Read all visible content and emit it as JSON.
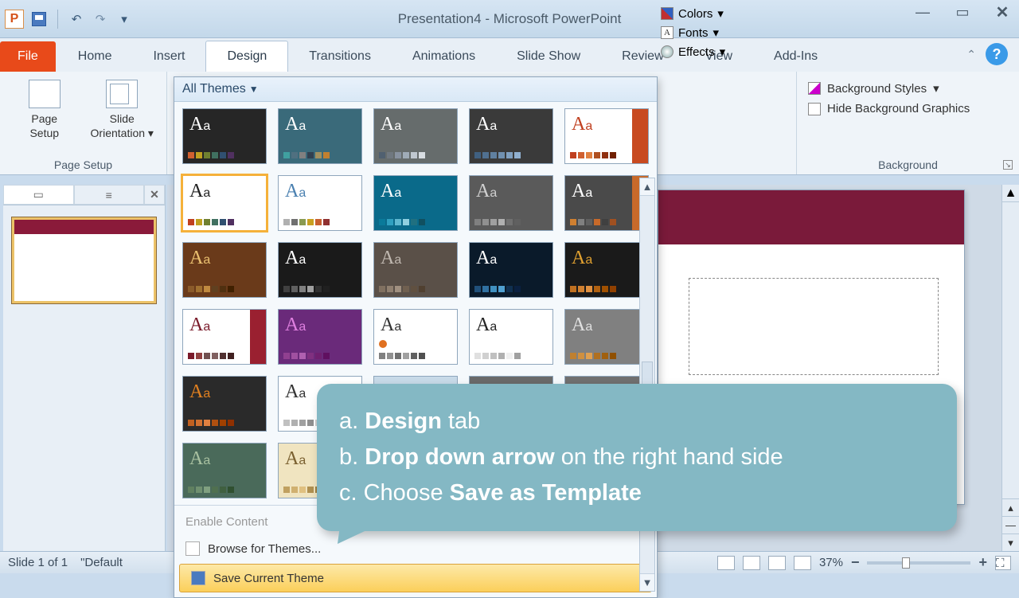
{
  "title": "Presentation4 - Microsoft PowerPoint",
  "qat": {
    "undo": "↶",
    "redo": "↷"
  },
  "tabs": {
    "file": "File",
    "items": [
      "Home",
      "Insert",
      "Design",
      "Transitions",
      "Animations",
      "Slide Show",
      "Review",
      "View",
      "Add-Ins"
    ],
    "active_index": 2
  },
  "page_setup": {
    "page_setup": "Page\nSetup",
    "slide_orientation": "Slide\nOrientation",
    "group": "Page Setup"
  },
  "themes": {
    "header": "All Themes",
    "thumbs": [
      {
        "bg": "#262626",
        "fg": "#ffffff",
        "strip": [
          "#d06030",
          "#c0a020",
          "#708030",
          "#407060",
          "#305070",
          "#503060"
        ]
      },
      {
        "bg": "#3a6a7a",
        "fg": "#ffffff",
        "strip": [
          "#40a0a0",
          "#507080",
          "#808080",
          "#304050",
          "#a09060",
          "#c08030"
        ]
      },
      {
        "bg": "#666c6c",
        "fg": "#ffffff",
        "strip": [
          "#506070",
          "#707880",
          "#8892a0",
          "#a0acb8",
          "#c0c8d0",
          "#d8dde2"
        ]
      },
      {
        "bg": "#3a3a3a",
        "fg": "#ffffff",
        "strip": [
          "#406080",
          "#507090",
          "#6080a0",
          "#7090b0",
          "#80a0c0",
          "#90b0d0"
        ]
      },
      {
        "bg": "#ffffff",
        "fg": "#c04020",
        "strip": [
          "#c04020",
          "#d06030",
          "#e08040",
          "#b05020",
          "#903010",
          "#702000"
        ],
        "accent": "#c84a20"
      },
      {
        "bg": "#ffffff",
        "fg": "#222222",
        "strip": [
          "#c04020",
          "#c0a020",
          "#708030",
          "#407060",
          "#305070",
          "#503060"
        ],
        "sel": true
      },
      {
        "bg": "#ffffff",
        "fg": "#4a80b0",
        "strip": [
          "#b0b0b0",
          "#707070",
          "#8a9a50",
          "#c8a020",
          "#c86030",
          "#903030"
        ]
      },
      {
        "bg": "#0a6a8a",
        "fg": "#ffffff",
        "strip": [
          "#0a7a9a",
          "#30a0c0",
          "#60b8d0",
          "#90d0e0",
          "#207080",
          "#105060"
        ]
      },
      {
        "bg": "#5a5a5a",
        "fg": "#d0d0d0",
        "strip": [
          "#808080",
          "#909090",
          "#a0a0a0",
          "#b0b0b0",
          "#707070",
          "#606060"
        ]
      },
      {
        "bg": "#4a4a4a",
        "fg": "#ffffff",
        "strip": [
          "#d08030",
          "#808080",
          "#606060",
          "#c86a2a",
          "#404040",
          "#a05020"
        ],
        "accent": "#c86a2a"
      },
      {
        "bg": "#6a3a1a",
        "fg": "#eac070",
        "strip": [
          "#8a5a2a",
          "#a07030",
          "#c08a40",
          "#604020",
          "#503010",
          "#402000"
        ]
      },
      {
        "bg": "#1a1a1a",
        "fg": "#ffffff",
        "strip": [
          "#404040",
          "#606060",
          "#808080",
          "#a0a0a0",
          "#303030",
          "#202020"
        ]
      },
      {
        "bg": "#5a5048",
        "fg": "#c0b8b0",
        "strip": [
          "#807060",
          "#908070",
          "#a09080",
          "#706050",
          "#605040",
          "#504030"
        ]
      },
      {
        "bg": "#0a1a2a",
        "fg": "#ffffff",
        "strip": [
          "#20507a",
          "#3070a0",
          "#4090c0",
          "#50a0d0",
          "#103050",
          "#0a2040"
        ]
      },
      {
        "bg": "#1a1a1a",
        "fg": "#e0a030",
        "strip": [
          "#c07020",
          "#d08030",
          "#e09040",
          "#b06010",
          "#a05000",
          "#904000"
        ]
      },
      {
        "bg": "#ffffff",
        "fg": "#7a1a2a",
        "strip": [
          "#7a1a2a",
          "#904040",
          "#705050",
          "#806060",
          "#503030",
          "#402020"
        ],
        "accent": "#9a2030"
      },
      {
        "bg": "#6a2a7a",
        "fg": "#e080e0",
        "strip": [
          "#904090",
          "#a050a0",
          "#b060b0",
          "#803080",
          "#702070",
          "#601060"
        ]
      },
      {
        "bg": "#ffffff",
        "fg": "#333333",
        "strip": [
          "#808080",
          "#909090",
          "#707070",
          "#a0a0a0",
          "#606060",
          "#505050"
        ],
        "dot": "#e07020"
      },
      {
        "bg": "#ffffff",
        "fg": "#222222",
        "strip": [
          "#e0e0e0",
          "#d0d0d0",
          "#c0c0c0",
          "#b0b0b0",
          "#f0f0f0",
          "#a0a0a0"
        ]
      },
      {
        "bg": "#808080",
        "fg": "#e0e0e0",
        "strip": [
          "#c08030",
          "#d09040",
          "#e0a050",
          "#b07020",
          "#a06010",
          "#905000"
        ]
      },
      {
        "bg": "#2a2a2a",
        "fg": "#e08020",
        "strip": [
          "#c06020",
          "#d07030",
          "#e08040",
          "#b05010",
          "#a04000",
          "#903000"
        ]
      },
      {
        "bg": "#ffffff",
        "fg": "#333333",
        "strip": [
          "#c0c0c0",
          "#b0b0b0",
          "#a0a0a0",
          "#909090",
          "#d0d0d0",
          "#808080"
        ]
      },
      {
        "bg": "#c8dae8",
        "fg": "#506070",
        "strip": [
          "#90a8c0",
          "#a0b8d0",
          "#b0c8e0",
          "#8098b0",
          "#7088a0",
          "#607890"
        ]
      },
      {
        "bg": "#6a6a6a",
        "fg": "#d0d0d0",
        "strip": [
          "#808080",
          "#909090",
          "#a0a0a0",
          "#707070",
          "#606060",
          "#b0b0b0"
        ]
      },
      {
        "bg": "#707070",
        "fg": "#ffffff",
        "strip": [
          "#909090",
          "#a0a0a0",
          "#808080",
          "#b0b0b0",
          "#707070",
          "#606060"
        ]
      },
      {
        "bg": "#4a6a5a",
        "fg": "#a8c0a0",
        "strip": [
          "#608060",
          "#709070",
          "#80a080",
          "#507050",
          "#406040",
          "#305030"
        ]
      },
      {
        "bg": "#f0e4c0",
        "fg": "#7a6030",
        "strip": [
          "#c0a060",
          "#d0b070",
          "#e0c080",
          "#b09050",
          "#a08040",
          "#907030"
        ]
      }
    ],
    "menu": {
      "enable_content": "Enable Content",
      "browse": "Browse for Themes...",
      "save": "Save Current Theme"
    }
  },
  "variants": {
    "colors": "Colors",
    "fonts": "Fonts",
    "effects": "Effects"
  },
  "background": {
    "styles": "Background Styles",
    "hide": "Hide Background Graphics",
    "group": "Background"
  },
  "slides": {
    "number": "1"
  },
  "callout": {
    "a_pre": "a. ",
    "a_bold": "Design",
    "a_post": " tab",
    "b_pre": "b. ",
    "b_bold": "Drop down arrow",
    "b_post": " on the right hand side",
    "c_pre": "c. Choose ",
    "c_bold": "Save as Template",
    "c_post": ""
  },
  "status": {
    "slide": "Slide 1 of 1",
    "theme": "\"Default",
    "zoom": "37%"
  }
}
